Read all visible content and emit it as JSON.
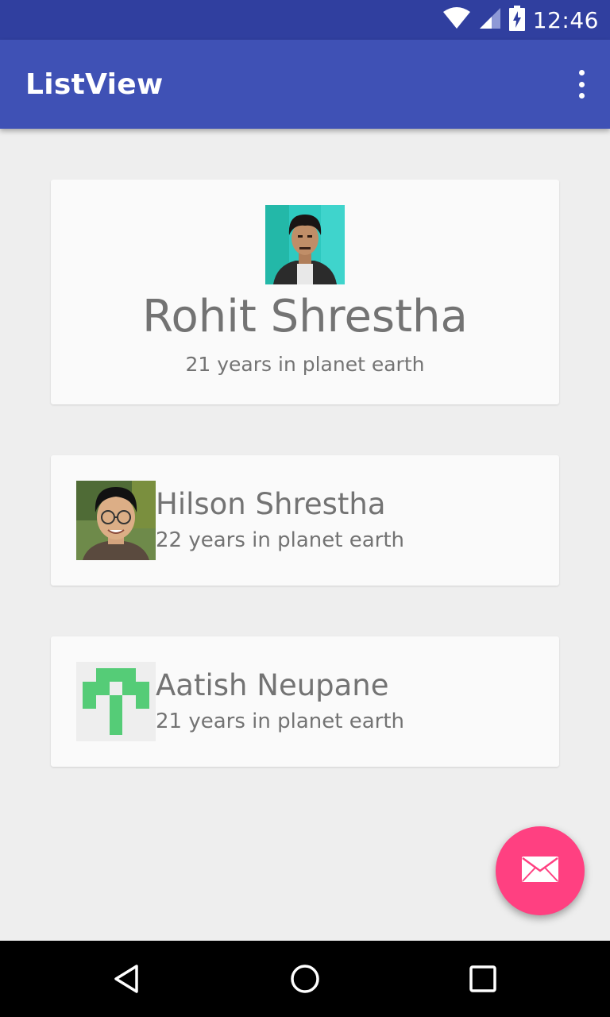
{
  "status_bar": {
    "time": "12:46",
    "icons": [
      "wifi-icon",
      "signal-icon",
      "battery-charging-icon"
    ]
  },
  "app_bar": {
    "title": "ListView",
    "menu_icon": "overflow-menu-icon"
  },
  "list": [
    {
      "name": "Rohit Shrestha",
      "subtitle": "21 years in planet earth",
      "avatar": "photo"
    },
    {
      "name": "Hilson Shrestha",
      "subtitle": "22 years in planet earth",
      "avatar": "photo"
    },
    {
      "name": "Aatish Neupane",
      "subtitle": "21 years in planet earth",
      "avatar": "identicon"
    }
  ],
  "fab": {
    "icon": "email-icon"
  },
  "nav_bar": {
    "icons": [
      "back-icon",
      "home-icon",
      "recents-icon"
    ]
  },
  "colors": {
    "primary": "#3f51b5",
    "primary_dark": "#303f9f",
    "accent": "#ff4081",
    "background": "#eeeeee",
    "card": "#fafafa",
    "text": "#737373",
    "identicon": "#55cc77"
  }
}
